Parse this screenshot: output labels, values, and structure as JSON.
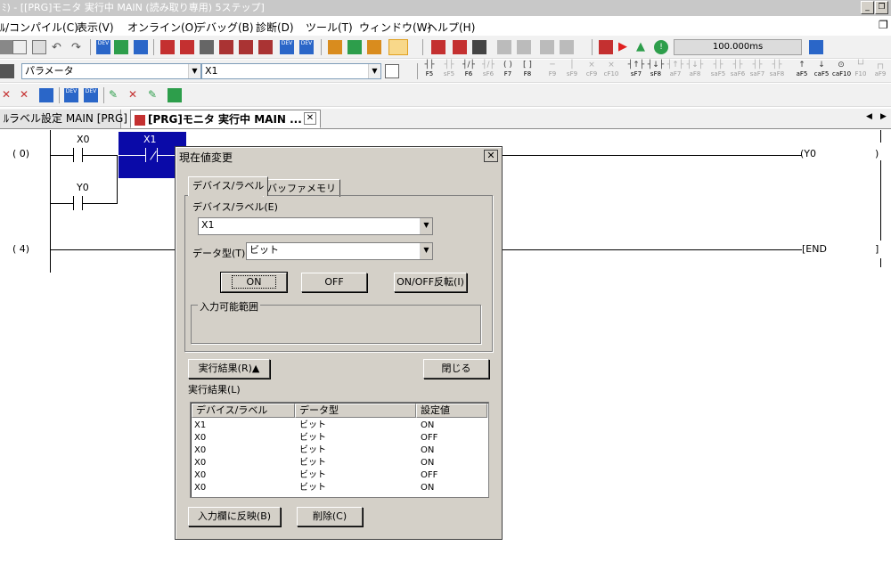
{
  "window": {
    "title": "ﾐ) - [[PRG]モニタ 実行中 MAIN (読み取り専用) 5ステップ]"
  },
  "menu": [
    "ﾙ/コンパイル(C)",
    "表示(V)",
    "オンライン(O)",
    "デバッグ(B)",
    "診断(D)",
    "ツール(T)",
    "ウィンドウ(W)",
    "ヘルプ(H)"
  ],
  "toolbar": {
    "scan_time": "100.000ms",
    "param_combo": "パラメータ",
    "device_combo": "X1"
  },
  "fkeys": [
    "F5",
    "sF5",
    "F6",
    "sF6",
    "F7",
    "F8",
    "F9",
    "sF9",
    "cF9",
    "cF10",
    "sF7",
    "sF8",
    "aF7",
    "aF8",
    "saF5",
    "saF6",
    "saF7",
    "saF8",
    "aF5",
    "caF5",
    "caF10",
    "F10",
    "aF9"
  ],
  "tabs": [
    {
      "label": "ﾙラベル設定 MAIN [PRG]"
    },
    {
      "label": "[PRG]モニタ 実行中 MAIN ..."
    }
  ],
  "ladder": {
    "step0": "(    0)",
    "step4": "(    4)",
    "contact_x0": "X0",
    "contact_x1": "X1",
    "contact_y0": "Y0",
    "coil_y0": "Y0",
    "end_label": "END"
  },
  "dialog": {
    "title": "現在値変更",
    "tab_device": "デバイス/ラベル",
    "tab_buffer": "バッファメモリ",
    "device_label": "デバイス/ラベル(E)",
    "device_value": "X1",
    "datatype_label": "データ型(T)",
    "datatype_value": "ビット",
    "on_button": "ON",
    "off_button": "OFF",
    "toggle_button": "ON/OFF反転(I)",
    "input_range_label": "入力可能範囲",
    "results_toggle_button": "実行結果(R)▲",
    "close_button": "閉じる",
    "results_label": "実行結果(L)",
    "columns": [
      "デバイス/ラベル",
      "データ型",
      "設定値"
    ],
    "rows": [
      {
        "device": "X1",
        "type": "ビット",
        "value": "ON"
      },
      {
        "device": "X0",
        "type": "ビット",
        "value": "OFF"
      },
      {
        "device": "X0",
        "type": "ビット",
        "value": "ON"
      },
      {
        "device": "X0",
        "type": "ビット",
        "value": "ON"
      },
      {
        "device": "X0",
        "type": "ビット",
        "value": "OFF"
      },
      {
        "device": "X0",
        "type": "ビット",
        "value": "ON"
      }
    ],
    "reflect_button": "入力欄に反映(B)",
    "delete_button": "削除(C)"
  }
}
